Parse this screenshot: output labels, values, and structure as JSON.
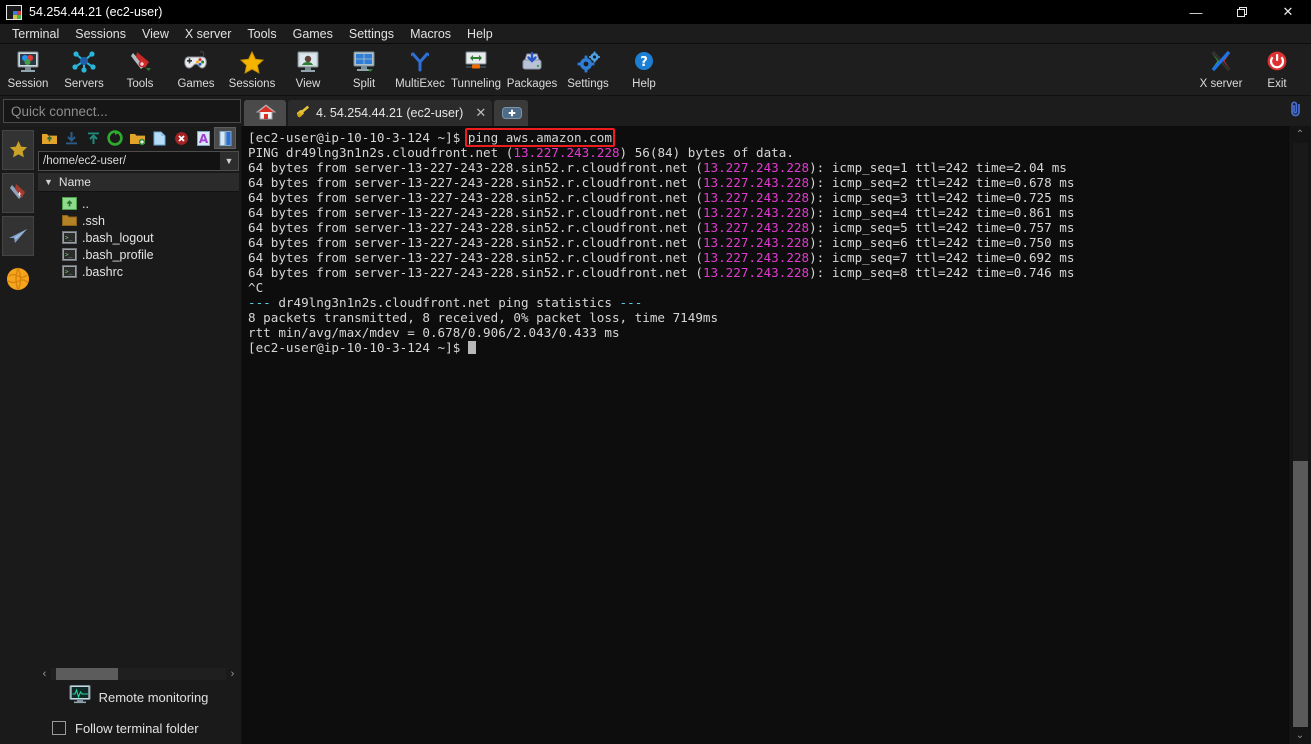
{
  "window": {
    "title": "54.254.44.21 (ec2-user)",
    "app_icon": "mobaxterm-icon",
    "minimize": "—",
    "maximize": "❐",
    "close": "✕"
  },
  "menubar": {
    "items": [
      {
        "label": "Terminal",
        "name": "menu-terminal"
      },
      {
        "label": "Sessions",
        "name": "menu-sessions"
      },
      {
        "label": "View",
        "name": "menu-view"
      },
      {
        "label": "X server",
        "name": "menu-xserver"
      },
      {
        "label": "Tools",
        "name": "menu-tools"
      },
      {
        "label": "Games",
        "name": "menu-games"
      },
      {
        "label": "Settings",
        "name": "menu-settings"
      },
      {
        "label": "Macros",
        "name": "menu-macros"
      },
      {
        "label": "Help",
        "name": "menu-help"
      }
    ]
  },
  "toolbar": {
    "left": [
      {
        "label": "Session",
        "icon": "session-icon"
      },
      {
        "label": "Servers",
        "icon": "servers-icon"
      },
      {
        "label": "Tools",
        "icon": "tools-icon"
      },
      {
        "label": "Games",
        "icon": "games-icon"
      },
      {
        "label": "Sessions",
        "icon": "sessions-star-icon"
      },
      {
        "label": "View",
        "icon": "view-icon"
      },
      {
        "label": "Split",
        "icon": "split-icon"
      },
      {
        "label": "MultiExec",
        "icon": "multiexec-icon"
      },
      {
        "label": "Tunneling",
        "icon": "tunneling-icon"
      },
      {
        "label": "Packages",
        "icon": "packages-icon"
      },
      {
        "label": "Settings",
        "icon": "settings-gear-icon"
      },
      {
        "label": "Help",
        "icon": "help-icon"
      }
    ],
    "right": [
      {
        "label": "X server",
        "icon": "xserver-icon"
      },
      {
        "label": "Exit",
        "icon": "exit-power-icon"
      }
    ]
  },
  "tabstrip": {
    "quick_connect_placeholder": "Quick connect...",
    "home_tab_icon": "home-icon",
    "session_tab": {
      "icon": "ssh-key-icon",
      "label": "4. 54.254.44.21 (ec2-user)",
      "close": "✕"
    },
    "new_tab": "+",
    "clip_icon": "paperclip-icon"
  },
  "rail": {
    "buttons": [
      {
        "name": "bookmarks-star-icon",
        "icon": "star-icon"
      },
      {
        "name": "tools-knife-icon",
        "icon": "knife-icon"
      },
      {
        "name": "send-plane-icon",
        "icon": "plane-icon"
      },
      {
        "name": "globe-icon",
        "icon": "globe-icon"
      }
    ]
  },
  "filebrowser": {
    "tools": [
      {
        "name": "parent-folder-icon",
        "icon": "up-folder"
      },
      {
        "name": "download-icon",
        "icon": "download"
      },
      {
        "name": "upload-icon",
        "icon": "upload"
      },
      {
        "name": "refresh-icon",
        "icon": "refresh"
      },
      {
        "name": "new-folder-icon",
        "icon": "new-folder"
      },
      {
        "name": "new-file-icon",
        "icon": "new-file"
      },
      {
        "name": "delete-icon",
        "icon": "delete"
      },
      {
        "name": "text-mode-icon",
        "icon": "text-mode"
      },
      {
        "name": "view-mode-icon",
        "icon": "view-mode"
      }
    ],
    "path": "/home/ec2-user/",
    "column_header": "Name",
    "files": [
      {
        "name": "..",
        "type": "parent"
      },
      {
        "name": ".ssh",
        "type": "folder"
      },
      {
        "name": ".bash_logout",
        "type": "script"
      },
      {
        "name": ".bash_profile",
        "type": "script"
      },
      {
        "name": ".bashrc",
        "type": "script"
      }
    ],
    "remote_monitoring": "Remote monitoring",
    "follow_terminal_folder": "Follow terminal folder",
    "follow_checked": false,
    "hscroll_left": "‹",
    "hscroll_right": "›"
  },
  "terminal": {
    "highlight_color": "#ee1c1c",
    "highlighted_command": "ping aws.amazon.com",
    "lines": [
      {
        "segments": [
          {
            "t": "[ec2-user@ip-10-10-3-124 ~]$ ",
            "c": "c-user"
          },
          {
            "t": "ping aws.amazon.com",
            "c": "c-user"
          }
        ]
      },
      {
        "segments": [
          {
            "t": "PING dr49lng3n1n2s.cloudfront.net (",
            "c": "c-user"
          },
          {
            "t": "13.227.243.228",
            "c": "c-ip"
          },
          {
            "t": ") 56(84) bytes of data.",
            "c": "c-user"
          }
        ]
      },
      {
        "segments": [
          {
            "t": "64 bytes from server-13-227-243-228.sin52.r.cloudfront.net (",
            "c": "c-user"
          },
          {
            "t": "13.227.243.228",
            "c": "c-ip"
          },
          {
            "t": "): icmp_seq=1 ttl=242 time=2.04 ms",
            "c": "c-user"
          }
        ]
      },
      {
        "segments": [
          {
            "t": "64 bytes from server-13-227-243-228.sin52.r.cloudfront.net (",
            "c": "c-user"
          },
          {
            "t": "13.227.243.228",
            "c": "c-ip"
          },
          {
            "t": "): icmp_seq=2 ttl=242 time=0.678 ms",
            "c": "c-user"
          }
        ]
      },
      {
        "segments": [
          {
            "t": "64 bytes from server-13-227-243-228.sin52.r.cloudfront.net (",
            "c": "c-user"
          },
          {
            "t": "13.227.243.228",
            "c": "c-ip"
          },
          {
            "t": "): icmp_seq=3 ttl=242 time=0.725 ms",
            "c": "c-user"
          }
        ]
      },
      {
        "segments": [
          {
            "t": "64 bytes from server-13-227-243-228.sin52.r.cloudfront.net (",
            "c": "c-user"
          },
          {
            "t": "13.227.243.228",
            "c": "c-ip"
          },
          {
            "t": "): icmp_seq=4 ttl=242 time=0.861 ms",
            "c": "c-user"
          }
        ]
      },
      {
        "segments": [
          {
            "t": "64 bytes from server-13-227-243-228.sin52.r.cloudfront.net (",
            "c": "c-user"
          },
          {
            "t": "13.227.243.228",
            "c": "c-ip"
          },
          {
            "t": "): icmp_seq=5 ttl=242 time=0.757 ms",
            "c": "c-user"
          }
        ]
      },
      {
        "segments": [
          {
            "t": "64 bytes from server-13-227-243-228.sin52.r.cloudfront.net (",
            "c": "c-user"
          },
          {
            "t": "13.227.243.228",
            "c": "c-ip"
          },
          {
            "t": "): icmp_seq=6 ttl=242 time=0.750 ms",
            "c": "c-user"
          }
        ]
      },
      {
        "segments": [
          {
            "t": "64 bytes from server-13-227-243-228.sin52.r.cloudfront.net (",
            "c": "c-user"
          },
          {
            "t": "13.227.243.228",
            "c": "c-ip"
          },
          {
            "t": "): icmp_seq=7 ttl=242 time=0.692 ms",
            "c": "c-user"
          }
        ]
      },
      {
        "segments": [
          {
            "t": "64 bytes from server-13-227-243-228.sin52.r.cloudfront.net (",
            "c": "c-user"
          },
          {
            "t": "13.227.243.228",
            "c": "c-ip"
          },
          {
            "t": "): icmp_seq=8 ttl=242 time=0.746 ms",
            "c": "c-user"
          }
        ]
      },
      {
        "segments": [
          {
            "t": "^C",
            "c": "c-user"
          }
        ]
      },
      {
        "segments": [
          {
            "t": "--- ",
            "c": "c-dash"
          },
          {
            "t": "dr49lng3n1n2s.cloudfront.net ping statistics ",
            "c": "c-user"
          },
          {
            "t": "---",
            "c": "c-dash"
          }
        ]
      },
      {
        "segments": [
          {
            "t": "8 packets transmitted, 8 received, 0% packet loss, time 7149ms",
            "c": "c-user"
          }
        ]
      },
      {
        "segments": [
          {
            "t": "rtt min/avg/max/mdev = 0.678/0.906/2.043/0.433 ms",
            "c": "c-user"
          }
        ]
      },
      {
        "segments": [
          {
            "t": "[ec2-user@ip-10-10-3-124 ~]$ ",
            "c": "c-user"
          }
        ],
        "cursor": true
      }
    ],
    "scroll_up": "⌃",
    "scroll_down": "⌄"
  }
}
